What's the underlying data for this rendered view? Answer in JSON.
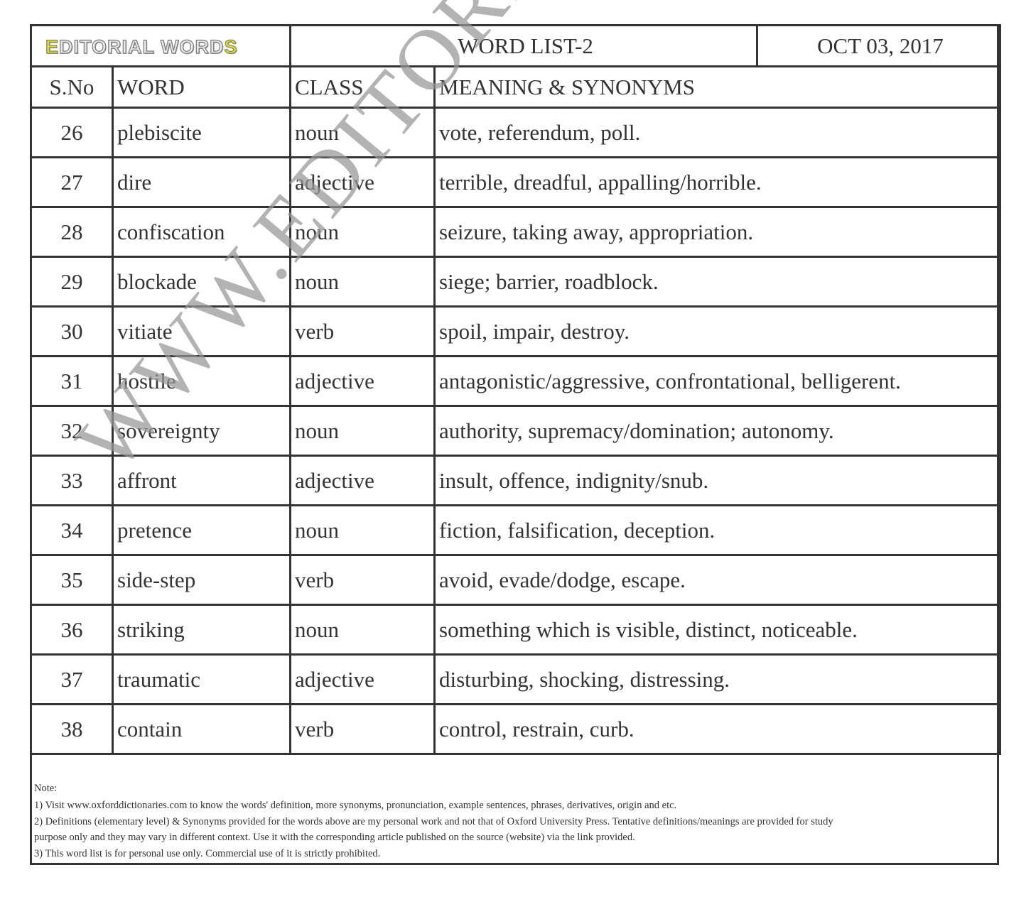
{
  "header": {
    "logo_text": "EDITORIAL WORDS",
    "title": "WORD LIST-2",
    "date": "OCT 03, 2017"
  },
  "columns": {
    "sno": "S.No",
    "word": "WORD",
    "class": "CLASS",
    "meaning": "MEANING & SYNONYMS"
  },
  "rows": [
    {
      "sno": "26",
      "word": "plebiscite",
      "class": "noun",
      "meaning": "vote, referendum, poll."
    },
    {
      "sno": "27",
      "word": "dire",
      "class": "adjective",
      "meaning": "terrible, dreadful, appalling/horrible."
    },
    {
      "sno": "28",
      "word": "confiscation",
      "class": "noun",
      "meaning": "seizure, taking away, appropriation."
    },
    {
      "sno": "29",
      "word": "blockade",
      "class": "noun",
      "meaning": "siege; barrier, roadblock."
    },
    {
      "sno": "30",
      "word": "vitiate",
      "class": "verb",
      "meaning": "spoil, impair, destroy."
    },
    {
      "sno": "31",
      "word": "hostile",
      "class": "adjective",
      "meaning": "antagonistic/aggressive, confrontational, belligerent."
    },
    {
      "sno": "32",
      "word": "sovereignty",
      "class": "noun",
      "meaning": "authority, supremacy/domination; autonomy."
    },
    {
      "sno": "33",
      "word": "affront",
      "class": "adjective",
      "meaning": "insult, offence, indignity/snub."
    },
    {
      "sno": "34",
      "word": "pretence",
      "class": "noun",
      "meaning": "fiction, falsification, deception."
    },
    {
      "sno": "35",
      "word": "side-step",
      "class": "verb",
      "meaning": "avoid, evade/dodge, escape."
    },
    {
      "sno": "36",
      "word": "striking",
      "class": "noun",
      "meaning": "something which is visible, distinct, noticeable."
    },
    {
      "sno": "37",
      "word": "traumatic",
      "class": "adjective",
      "meaning": "disturbing, shocking, distressing."
    },
    {
      "sno": "38",
      "word": "contain",
      "class": "verb",
      "meaning": "control, restrain, curb."
    }
  ],
  "notes": {
    "heading": "Note:",
    "lines": [
      "1) Visit www.oxforddictionaries.com to know the words' definition, more synonyms, pronunciation, example sentences, phrases, derivatives, origin and etc.",
      "2) Definitions (elementary level) & Synonyms provided for the words above are my personal work and not that of Oxford University Press. Tentative definitions/meanings are provided for study",
      "purpose only and they may vary in different context. Use it with the corresponding article published on the source (website) via the link provided.",
      "3) This word list is for personal use only. Commercial use of it is strictly prohibited."
    ]
  },
  "watermark": "WWW.EDITORIALWORDS.COM"
}
